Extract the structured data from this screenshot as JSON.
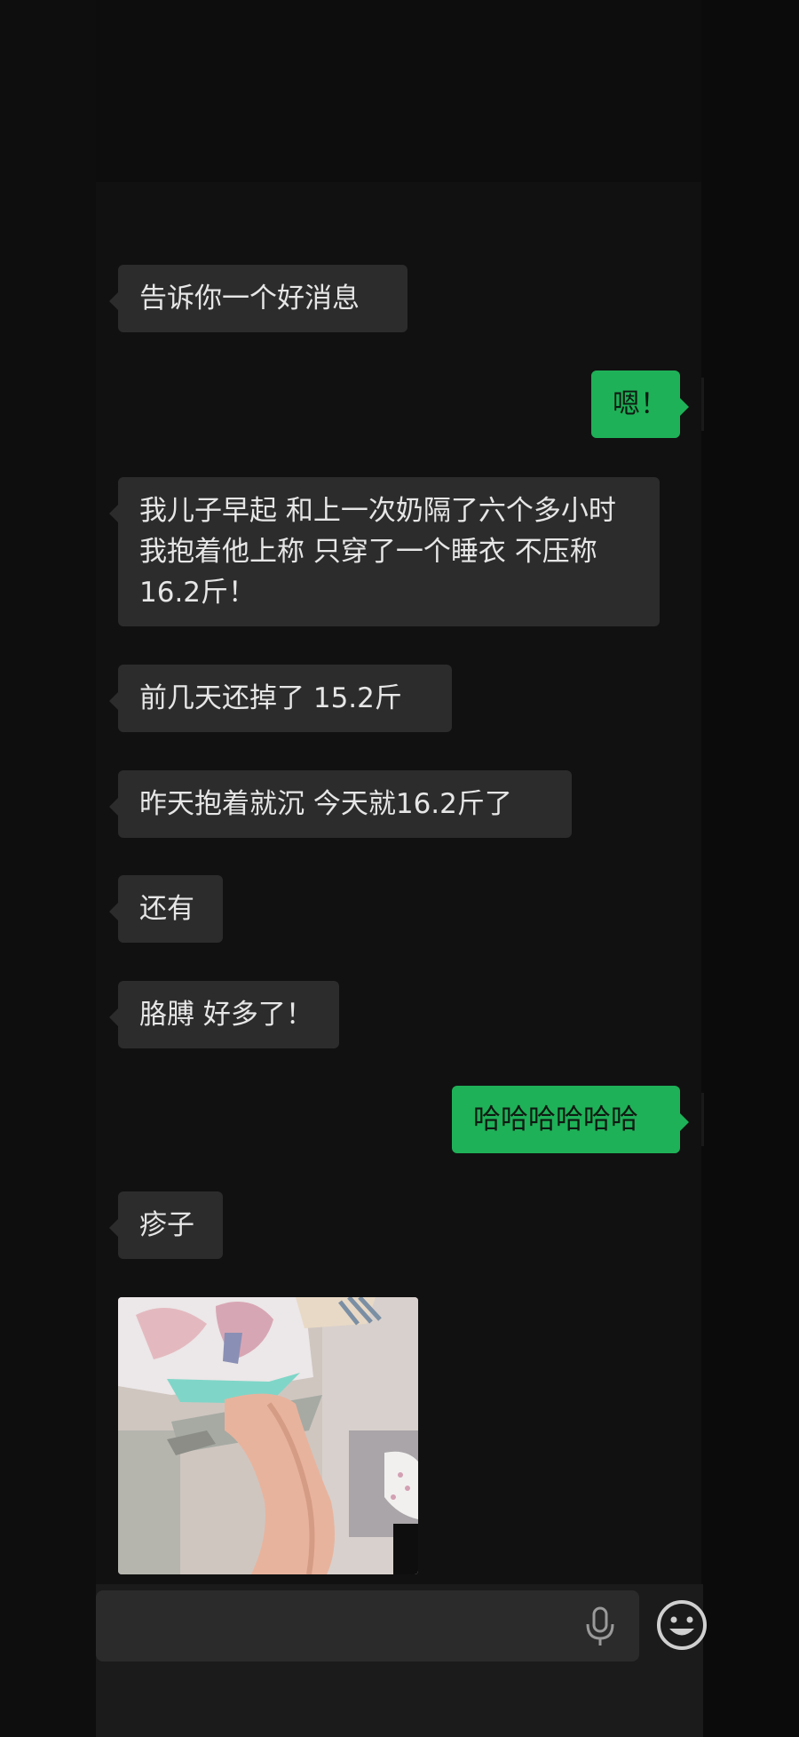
{
  "messages": [
    {
      "side": "in",
      "text": "告诉你一个好消息"
    },
    {
      "side": "out",
      "text": "嗯！"
    },
    {
      "side": "in",
      "text": "我儿子早起 和上一次奶隔了六个多小时 我抱着他上称 只穿了一个睡衣 不压称 16.2斤！"
    },
    {
      "side": "in",
      "text": "前几天还掉了 15.2斤"
    },
    {
      "side": "in",
      "text": "昨天抱着就沉 今天就16.2斤了"
    },
    {
      "side": "in",
      "text": "还有"
    },
    {
      "side": "in",
      "text": "胳膊 好多了！"
    },
    {
      "side": "out",
      "text": "哈哈哈哈哈哈"
    },
    {
      "side": "in",
      "text": "疹子"
    }
  ],
  "photo": {
    "icon": "baby-arm-photo"
  },
  "input_bar": {
    "mic_icon": "microphone-icon",
    "emoji_icon": "emoji-icon"
  },
  "colors": {
    "incoming": "#2c2c2c",
    "outgoing": "#1fb158",
    "background": "#111111"
  }
}
